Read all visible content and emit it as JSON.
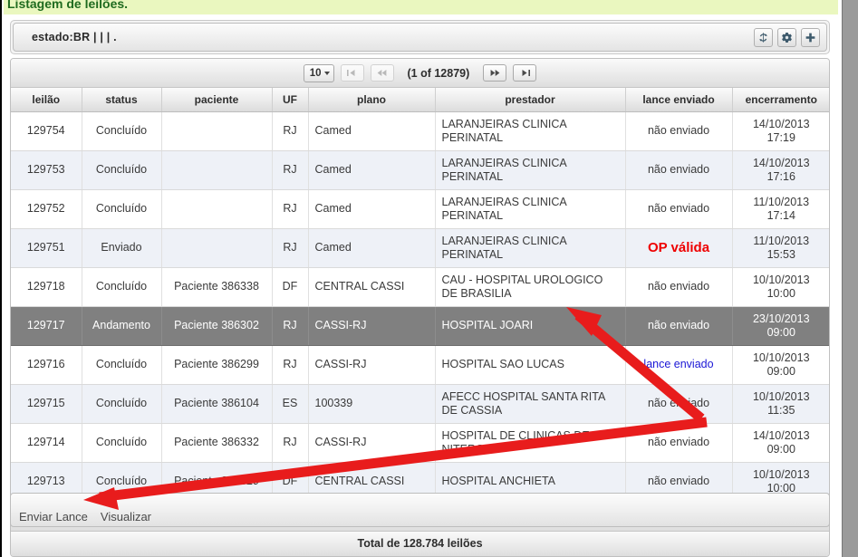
{
  "banner": {
    "title": "Listagem de leilões."
  },
  "filter": {
    "query": "estado:BR | | | .",
    "tools": [
      {
        "name": "refresh-icon",
        "label": "Atualizar"
      },
      {
        "name": "gear-icon",
        "label": "Configurar"
      },
      {
        "name": "plus-icon",
        "label": "Adicionar"
      }
    ]
  },
  "pager": {
    "page_size": "10",
    "page_info": "(1 of 12879)",
    "first_label": "Primeira",
    "prev_label": "Anterior",
    "next_label": "Próxima",
    "last_label": "Última"
  },
  "table": {
    "headers": [
      "leilão",
      "status",
      "paciente",
      "UF",
      "plano",
      "prestador",
      "lance enviado",
      "encerramento"
    ],
    "rows": [
      {
        "leilao": "129754",
        "status": "Concluído",
        "paciente": "",
        "uf": "RJ",
        "plano": "Camed",
        "prestador": "LARANJEIRAS CLINICA PERINATAL",
        "lance": "não enviado",
        "lance_style": "plain",
        "encerramento": "14/10/2013 17:19",
        "selected": false
      },
      {
        "leilao": "129753",
        "status": "Concluído",
        "paciente": "",
        "uf": "RJ",
        "plano": "Camed",
        "prestador": "LARANJEIRAS CLINICA PERINATAL",
        "lance": "não enviado",
        "lance_style": "plain",
        "encerramento": "14/10/2013 17:16",
        "selected": false
      },
      {
        "leilao": "129752",
        "status": "Concluído",
        "paciente": "",
        "uf": "RJ",
        "plano": "Camed",
        "prestador": "LARANJEIRAS CLINICA PERINATAL",
        "lance": "não enviado",
        "lance_style": "plain",
        "encerramento": "11/10/2013 17:14",
        "selected": false
      },
      {
        "leilao": "129751",
        "status": "Enviado",
        "paciente": "",
        "uf": "RJ",
        "plano": "Camed",
        "prestador": "LARANJEIRAS CLINICA PERINATAL",
        "lance": "OP válida",
        "lance_style": "op-valida",
        "encerramento": "11/10/2013 15:53",
        "selected": false
      },
      {
        "leilao": "129718",
        "status": "Concluído",
        "paciente": "Paciente 386338",
        "uf": "DF",
        "plano": "CENTRAL CASSI",
        "prestador": "CAU - HOSPITAL UROLOGICO DE BRASILIA",
        "lance": "não enviado",
        "lance_style": "plain",
        "encerramento": "10/10/2013 10:00",
        "selected": false
      },
      {
        "leilao": "129717",
        "status": "Andamento",
        "paciente": "Paciente 386302",
        "uf": "RJ",
        "plano": "CASSI-RJ",
        "prestador": "HOSPITAL JOARI",
        "lance": "não enviado",
        "lance_style": "plain",
        "encerramento": "23/10/2013 09:00",
        "selected": true
      },
      {
        "leilao": "129716",
        "status": "Concluído",
        "paciente": "Paciente 386299",
        "uf": "RJ",
        "plano": "CASSI-RJ",
        "prestador": "HOSPITAL SAO LUCAS",
        "lance": "lance enviado",
        "lance_style": "link",
        "encerramento": "10/10/2013 09:00",
        "selected": false
      },
      {
        "leilao": "129715",
        "status": "Concluído",
        "paciente": "Paciente 386104",
        "uf": "ES",
        "plano": "100339",
        "prestador": "AFECC HOSPITAL SANTA RITA DE CASSIA",
        "lance": "não enviado",
        "lance_style": "plain",
        "encerramento": "10/10/2013 11:35",
        "selected": false
      },
      {
        "leilao": "129714",
        "status": "Concluído",
        "paciente": "Paciente 386332",
        "uf": "RJ",
        "plano": "CASSI-RJ",
        "prestador": "HOSPITAL DE CLINICAS DE NITEROI",
        "lance": "não enviado",
        "lance_style": "plain",
        "encerramento": "14/10/2013 09:00",
        "selected": false
      },
      {
        "leilao": "129713",
        "status": "Concluído",
        "paciente": "Paciente 386329",
        "uf": "DF",
        "plano": "CENTRAL CASSI",
        "prestador": "HOSPITAL ANCHIETA",
        "lance": "não enviado",
        "lance_style": "plain",
        "encerramento": "10/10/2013 10:00",
        "selected": false
      }
    ]
  },
  "totals": {
    "text": "Total de 128.784 leilões"
  },
  "actions": [
    {
      "name": "enviar-lance",
      "label": "Enviar Lance"
    },
    {
      "name": "visualizar",
      "label": "Visualizar"
    }
  ],
  "annotations": {
    "color": "#e81c1c",
    "arrows": [
      {
        "name": "arrow-to-selected-row"
      },
      {
        "name": "arrow-to-enviar-lance"
      }
    ]
  },
  "colors": {
    "banner_bg": "#eaf7bf",
    "banner_text": "#1f6b1f",
    "selected_row": "#808080",
    "link": "#1b17d6",
    "alert": "#ee0000",
    "annotation": "#e81c1c"
  }
}
